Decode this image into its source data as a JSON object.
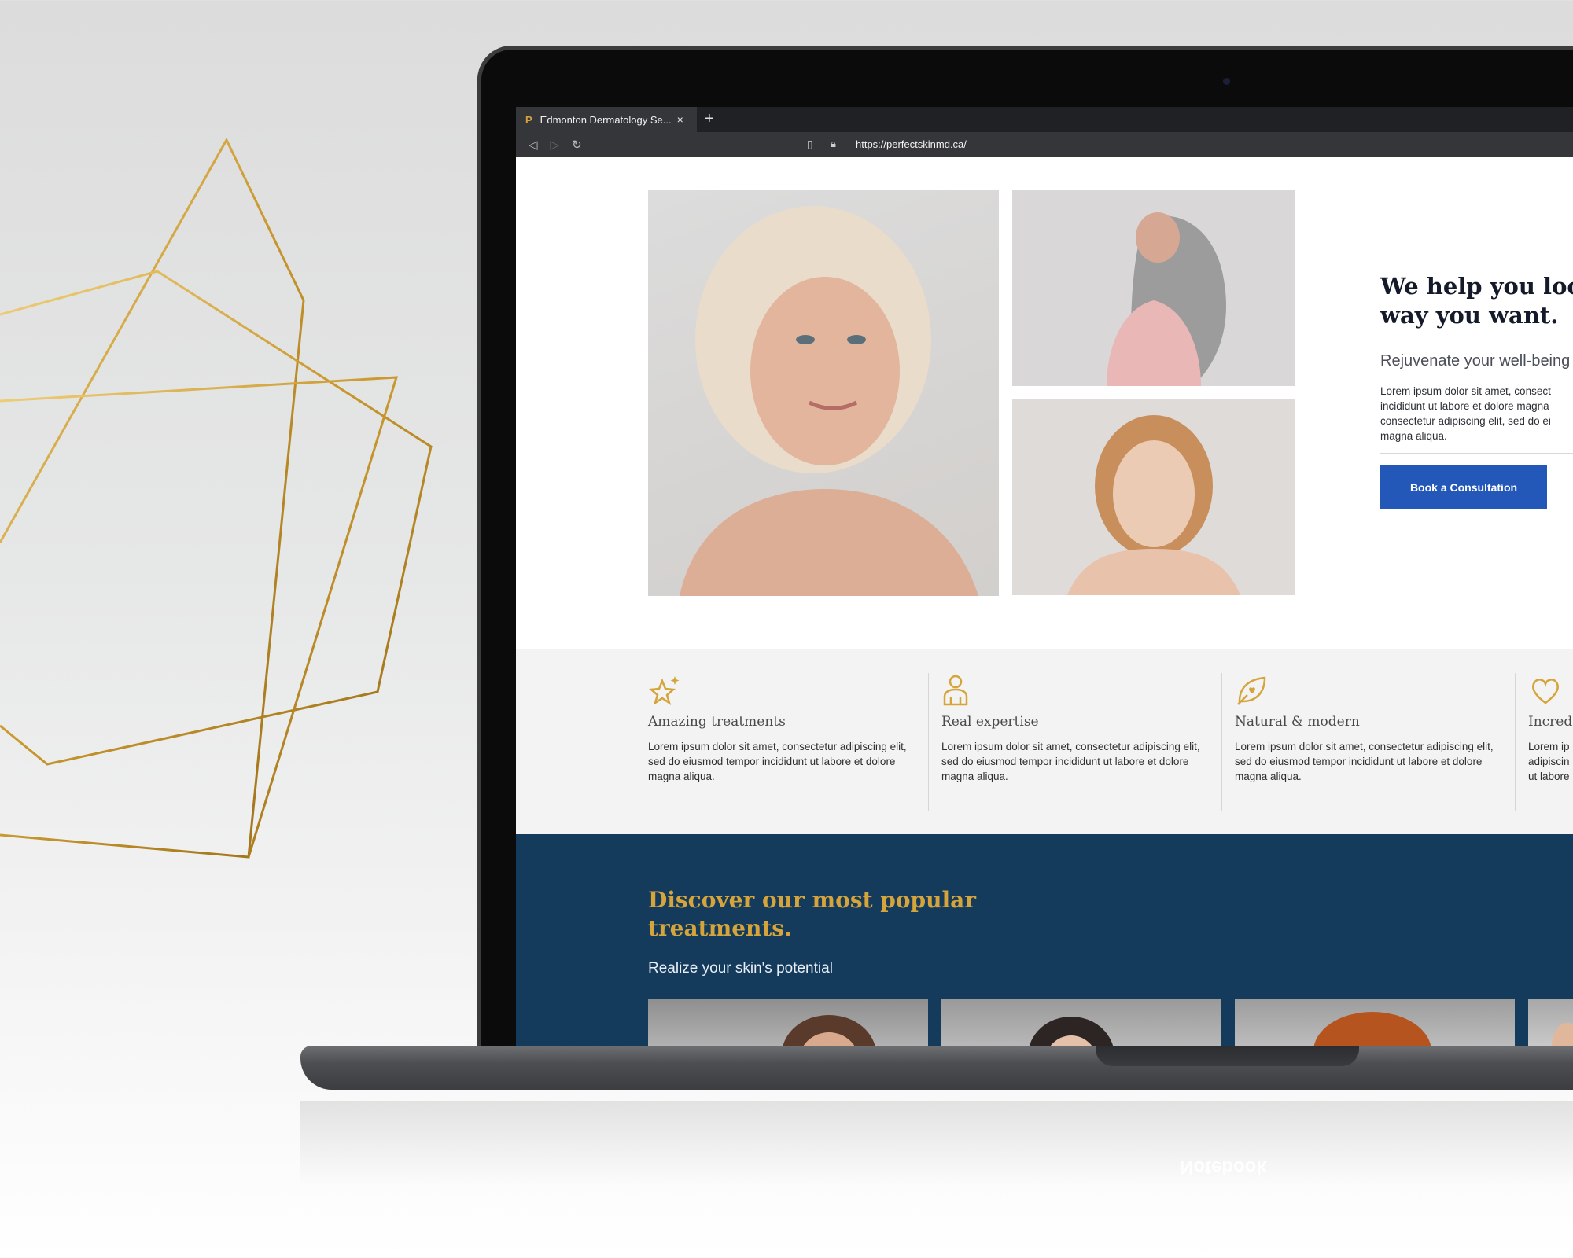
{
  "browser": {
    "tab_title": "Edmonton Dermatology Se...",
    "tab_favicon": "P",
    "tab_close": "×",
    "new_tab": "+",
    "url": "https://perfectskinmd.ca/",
    "back_icon": "◁",
    "forward_icon": "▷",
    "reload_icon": "↻",
    "bookmark_icon": "🔖",
    "lock_icon": "🔒"
  },
  "hero": {
    "heading": "We help you look\nway you want.",
    "subheading": "Rejuvenate your well-being",
    "body": "Lorem ipsum dolor sit amet, consect incididunt ut labore et dolore magna consectetur adipiscing elit, sed do ei magna aliqua.",
    "cta_label": "Book a Consultation",
    "images": [
      "portrait-mature-woman",
      "woman-grey-hair-back",
      "young-woman-portrait"
    ]
  },
  "features": [
    {
      "icon": "sparkle-star-icon",
      "title": "Amazing treatments",
      "text": "Lorem ipsum dolor sit amet, consectetur adipiscing elit, sed do eiusmod tempor incididunt ut labore et dolore magna aliqua."
    },
    {
      "icon": "expert-person-icon",
      "title": "Real expertise",
      "text": "Lorem ipsum dolor sit amet, consectetur adipiscing elit, sed do eiusmod tempor incididunt ut labore et dolore magna aliqua."
    },
    {
      "icon": "leaf-heart-icon",
      "title": "Natural & modern",
      "text": "Lorem ipsum dolor sit amet, consectetur adipiscing elit, sed do eiusmod tempor incididunt ut labore et dolore magna aliqua."
    },
    {
      "icon": "heart-icon",
      "title": "Incred",
      "text": "Lorem ip adipiscin ut labore"
    }
  ],
  "popular": {
    "heading": "Discover our most popular\ntreatments.",
    "subheading": "Realize your skin's potential"
  },
  "device": {
    "reflection_word": "Notebook"
  },
  "colors": {
    "gold": "#d5a43a",
    "navy": "#143a5c",
    "cta_blue": "#2357b8"
  }
}
